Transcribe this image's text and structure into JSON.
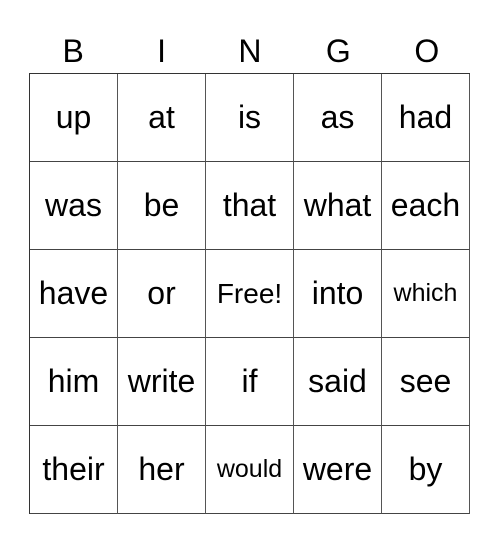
{
  "header": {
    "letters": [
      "B",
      "I",
      "N",
      "G",
      "O"
    ]
  },
  "grid": {
    "rows": [
      [
        "up",
        "at",
        "is",
        "as",
        "had"
      ],
      [
        "was",
        "be",
        "that",
        "what",
        "each"
      ],
      [
        "have",
        "or",
        "Free!",
        "into",
        "which"
      ],
      [
        "him",
        "write",
        "if",
        "said",
        "see"
      ],
      [
        "their",
        "her",
        "would",
        "were",
        "by"
      ]
    ]
  }
}
